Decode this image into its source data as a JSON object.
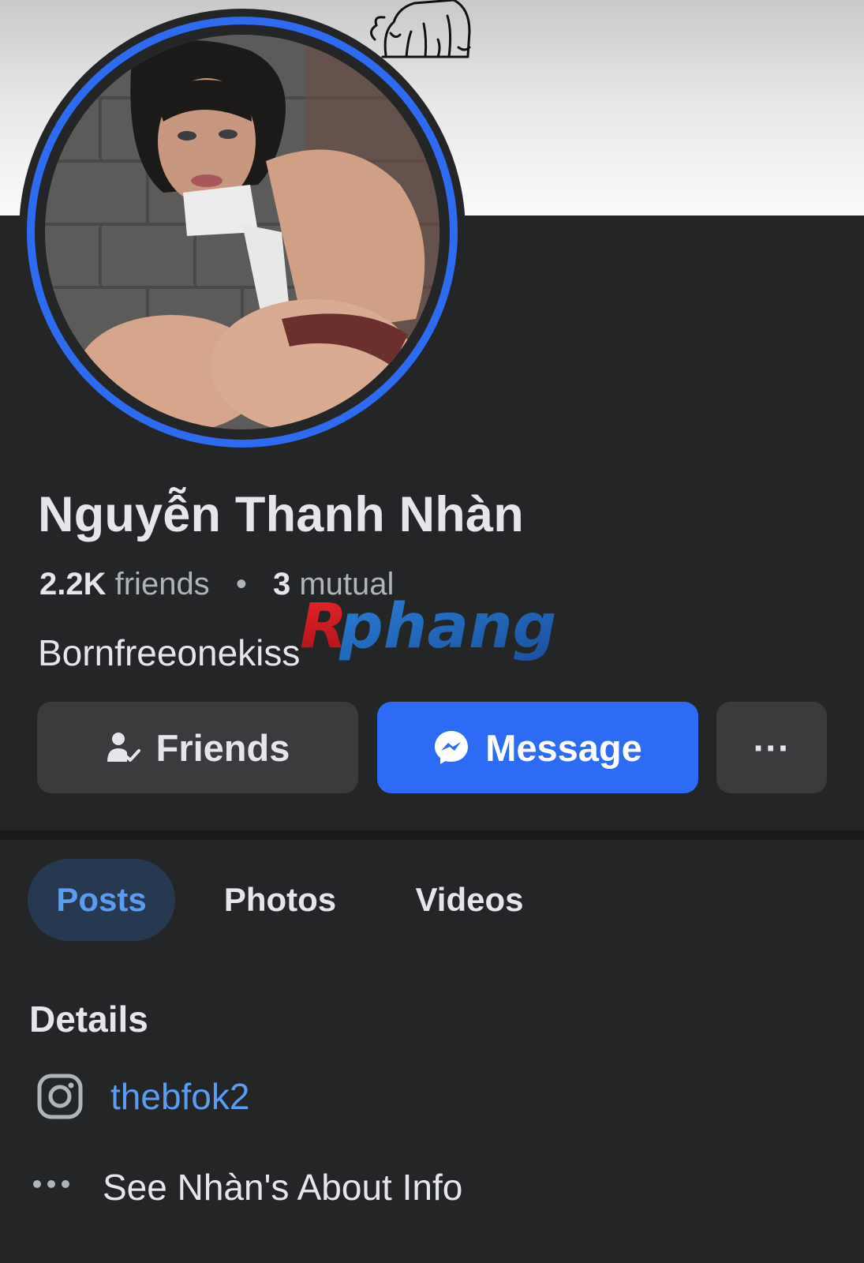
{
  "profile": {
    "name": "Nguyễn Thanh Nhàn",
    "friends_count": "2.2K",
    "friends_label": "friends",
    "separator": "•",
    "mutual_count": "3",
    "mutual_label": "mutual",
    "bio": "Bornfreeonekiss"
  },
  "watermark": {
    "text": "Rphang"
  },
  "actions": {
    "friends_label": "Friends",
    "message_label": "Message",
    "more_label": "···"
  },
  "tabs": [
    {
      "label": "Posts",
      "active": true
    },
    {
      "label": "Photos",
      "active": false
    },
    {
      "label": "Videos",
      "active": false
    }
  ],
  "details": {
    "title": "Details",
    "instagram_handle": "thebfok2",
    "about_link": "See Nhàn's About Info"
  },
  "icons": {
    "friends": "person-check-icon",
    "message": "messenger-icon",
    "more": "more-dots-icon",
    "instagram": "instagram-icon",
    "about": "more-dots-icon"
  },
  "colors": {
    "background": "#242526",
    "accent_blue": "#2d6bf5",
    "link_blue": "#5b9bf0",
    "avatar_ring": "#2f6bf0",
    "secondary_button": "#3a3b3c"
  }
}
